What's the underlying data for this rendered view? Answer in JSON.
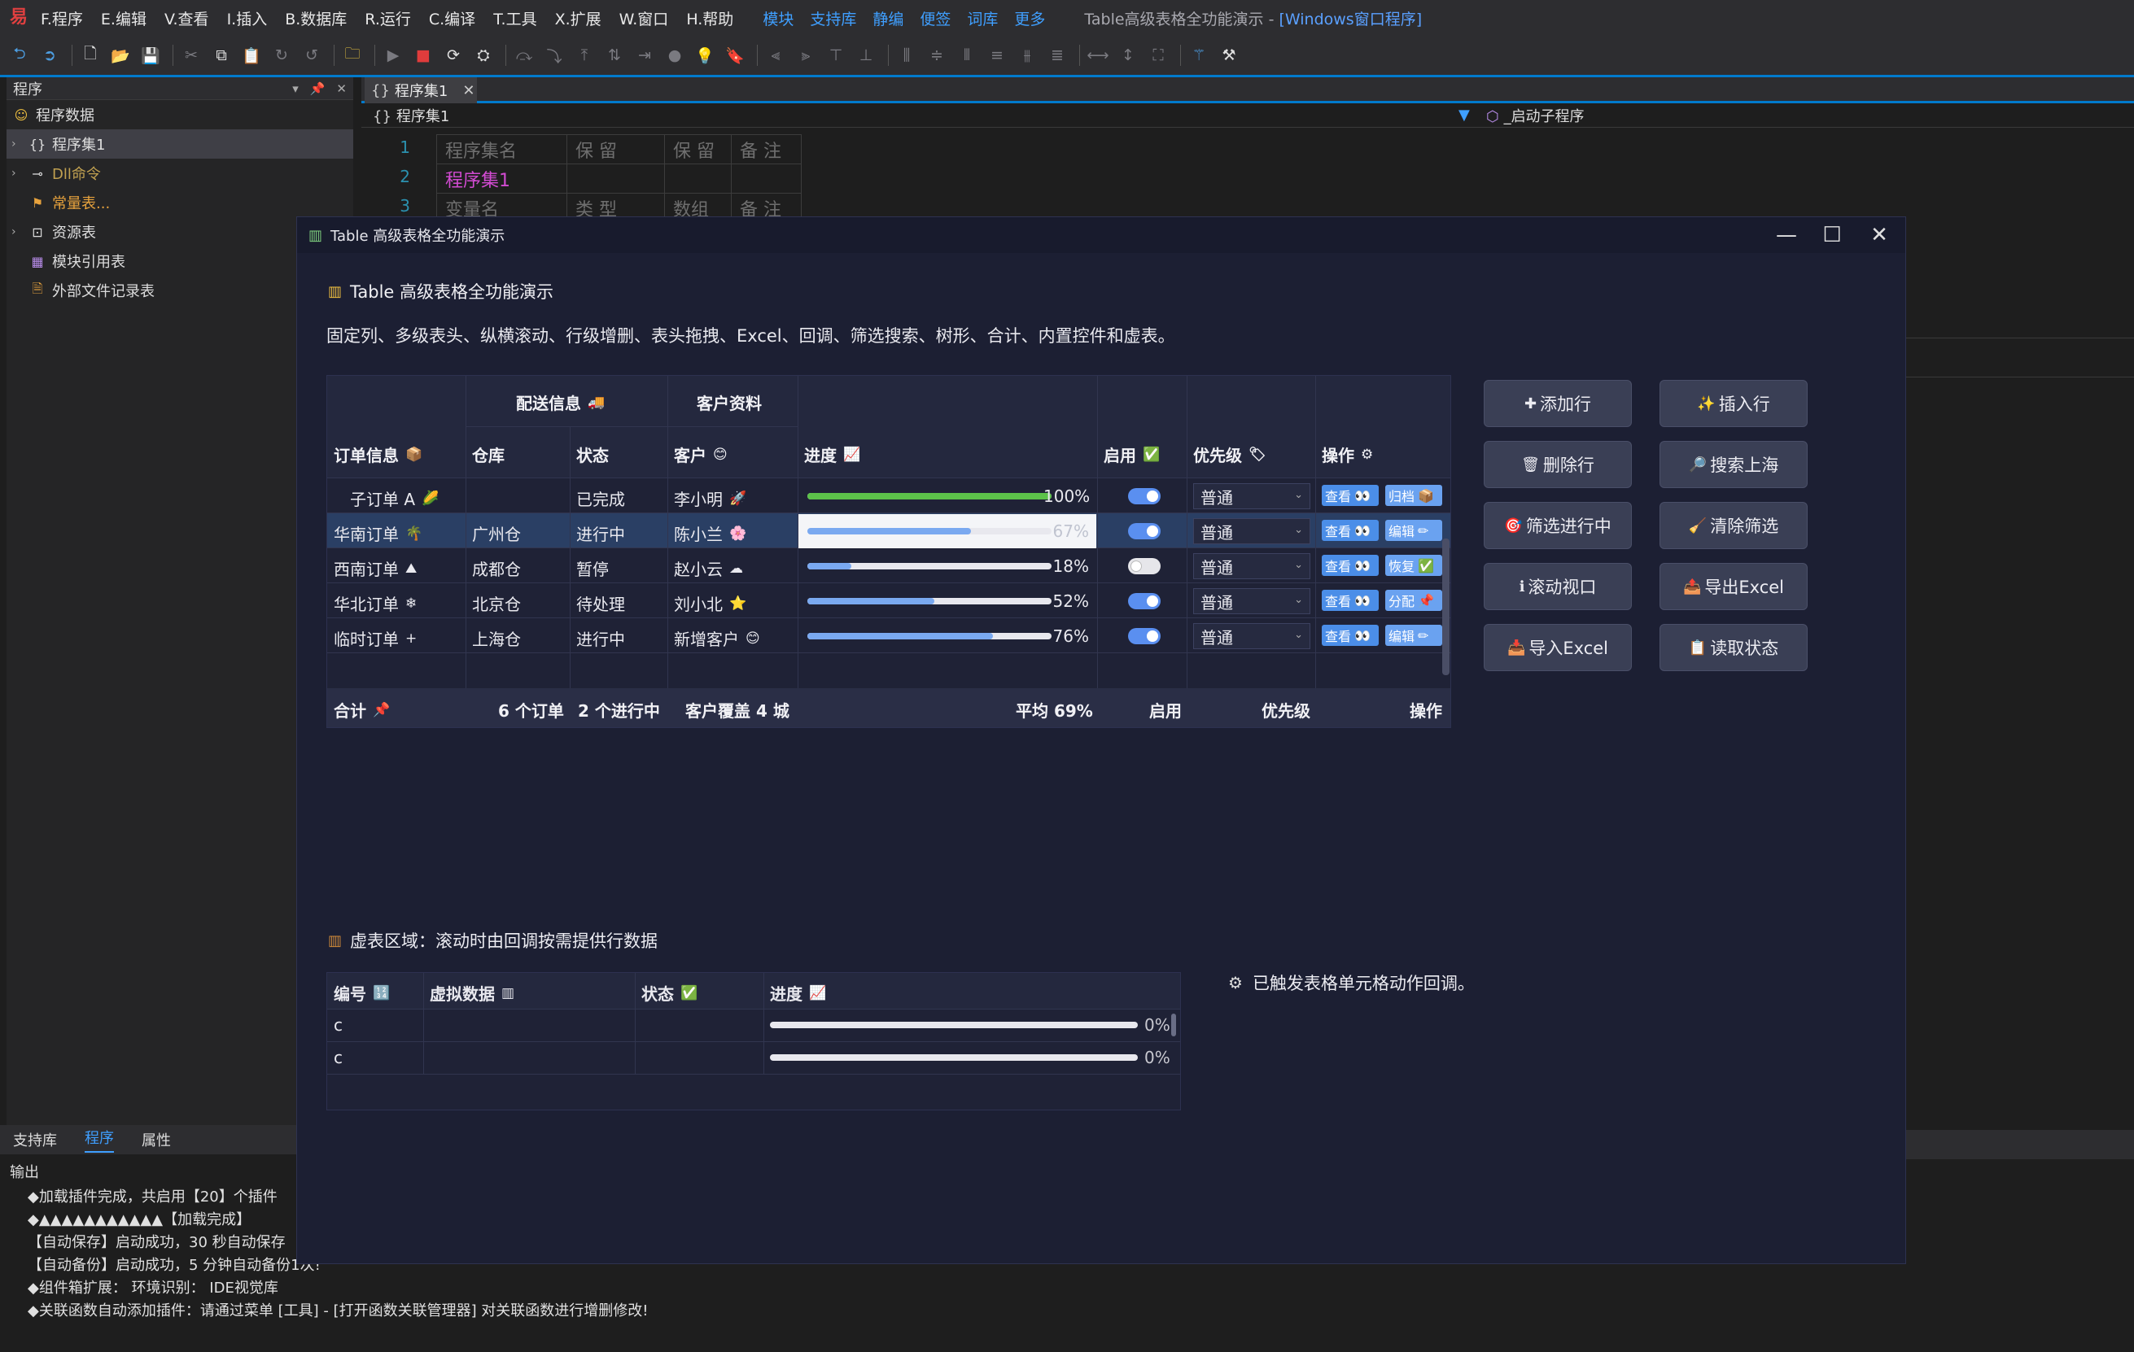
{
  "ide": {
    "menus": [
      "F.程序",
      "E.编辑",
      "V.查看",
      "I.插入",
      "B.数据库",
      "R.运行",
      "C.编译",
      "T.工具",
      "X.扩展",
      "W.窗口",
      "H.帮助"
    ],
    "links": [
      "模块",
      "支持库",
      "静编",
      "便签",
      "词库",
      "更多"
    ],
    "title_prefix": "Table高级表格全功能演示 - ",
    "title_suffix": "[Windows窗口程序]",
    "left_panel_title": "程序",
    "tree": [
      {
        "label": "程序数据",
        "icon": "folder-icon"
      },
      {
        "label": "程序集1",
        "icon": "braces-icon"
      },
      {
        "label": "Dll命令",
        "icon": "dll-icon"
      },
      {
        "label": "常量表...",
        "icon": "constant-icon"
      },
      {
        "label": "资源表",
        "icon": "resource-icon"
      },
      {
        "label": "模块引用表",
        "icon": "module-icon"
      },
      {
        "label": "外部文件记录表",
        "icon": "file-icon"
      }
    ],
    "editor_tab": "程序集1",
    "nav_left": "程序集1",
    "nav_right": "_启动子程序",
    "code_rows": [
      [
        "程序集名",
        "保 留",
        "保 留",
        "备 注"
      ],
      [
        "程序集1",
        "",
        "",
        ""
      ],
      [
        "变量名",
        "类 型",
        "数组",
        "备 注"
      ]
    ],
    "bottom_tabs": [
      "支持库",
      "程序",
      "属性"
    ],
    "output_title": "输出",
    "output_lines": [
      "◆加载插件完成，共启用【20】个插件",
      "◆▲▲▲▲▲▲▲▲▲▲▲【加载完成】",
      "【自动保存】启动成功，30 秒自动保存",
      "【自动备份】启动成功，5 分钟自动备份1次!",
      "◆组件箱扩展：   环境识别：  IDE视觉库",
      "◆关联函数自动添加插件：请通过菜单 [工具] - [打开函数关联管理器] 对关联函数进行增删修改!"
    ]
  },
  "window": {
    "title": "Table 高级表格全功能演示",
    "heading": "Table 高级表格全功能演示",
    "subtitle": "固定列、多级表头、纵横滚动、行级增删、表头拖拽、Excel、回调、筛选搜索、树形、合计、内置控件和虚表。",
    "table": {
      "group_headers": {
        "delivery": "配送信息",
        "customer": "客户资料"
      },
      "columns": [
        "订单信息",
        "仓库",
        "状态",
        "客户",
        "进度",
        "启用",
        "优先级",
        "操作"
      ],
      "rows": [
        {
          "order": "子订单 A",
          "order_icon": "🌽",
          "warehouse": "",
          "status": "已完成",
          "customer": "李小明",
          "cust_icon": "🚀",
          "progress": 1.0,
          "progress_text": "100%",
          "enabled": true,
          "priority": "普通",
          "btn1": "查看",
          "btn2": "归档",
          "btn2_icon": "📦"
        },
        {
          "order": "华南订单",
          "order_icon": "🌴",
          "warehouse": "广州仓",
          "status": "进行中",
          "customer": "陈小兰",
          "cust_icon": "🌸",
          "progress": 0.67,
          "progress_text": "67%",
          "enabled": true,
          "priority": "普通",
          "btn1": "查看",
          "btn2": "编辑",
          "btn2_icon": "✏"
        },
        {
          "order": "西南订单",
          "order_icon": "⛰",
          "warehouse": "成都仓",
          "status": "暂停",
          "customer": "赵小云",
          "cust_icon": "☁",
          "progress": 0.18,
          "progress_text": "18%",
          "enabled": false,
          "priority": "普通",
          "btn1": "查看",
          "btn2": "恢复",
          "btn2_icon": "✅"
        },
        {
          "order": "华北订单",
          "order_icon": "❄",
          "warehouse": "北京仓",
          "status": "待处理",
          "customer": "刘小北",
          "cust_icon": "⭐",
          "progress": 0.52,
          "progress_text": "52%",
          "enabled": true,
          "priority": "普通",
          "btn1": "查看",
          "btn2": "分配",
          "btn2_icon": "📌"
        },
        {
          "order": "临时订单",
          "order_icon": "+",
          "warehouse": "上海仓",
          "status": "进行中",
          "customer": "新增客户",
          "cust_icon": "😊",
          "progress": 0.76,
          "progress_text": "76%",
          "enabled": true,
          "priority": "普通",
          "btn1": "查看",
          "btn2": "编辑",
          "btn2_icon": "✏"
        }
      ],
      "totals": {
        "label": "合计",
        "orders": "6 个订单",
        "running": "2 个进行中",
        "coverage": "客户覆盖 4 城",
        "avg": "平均 69%",
        "enabled": "启用",
        "priority": "优先级",
        "ops": "操作"
      }
    },
    "buttons": [
      {
        "label": "添加行",
        "icon": "✚"
      },
      {
        "label": "插入行",
        "icon": "✨"
      },
      {
        "label": "删除行",
        "icon": "🗑"
      },
      {
        "label": "搜索上海",
        "icon": "🔎"
      },
      {
        "label": "筛选进行中",
        "icon": "🎯"
      },
      {
        "label": "清除筛选",
        "icon": "🧹"
      },
      {
        "label": "滚动视口",
        "icon": "ℹ"
      },
      {
        "label": "导出Excel",
        "icon": "📤"
      },
      {
        "label": "导入Excel",
        "icon": "📥"
      },
      {
        "label": "读取状态",
        "icon": "📋"
      }
    ],
    "virtual": {
      "heading": "虚表区域：滚动时由回调按需提供行数据",
      "columns": [
        "编号",
        "虚拟数据",
        "状态",
        "进度"
      ],
      "rows": [
        {
          "id": "c",
          "data": "",
          "status": "",
          "progress": 0.0,
          "progress_text": "0%"
        },
        {
          "id": "c",
          "data": "",
          "status": "",
          "progress": 0.0,
          "progress_text": "0%"
        }
      ]
    },
    "notice": "已触发表格单元格动作回调。"
  },
  "colors": {
    "accent": "#4b8ee8",
    "selected_row": "#2a3f64",
    "window_bg": "#1c1f33",
    "ide_blue": "#007acc"
  }
}
